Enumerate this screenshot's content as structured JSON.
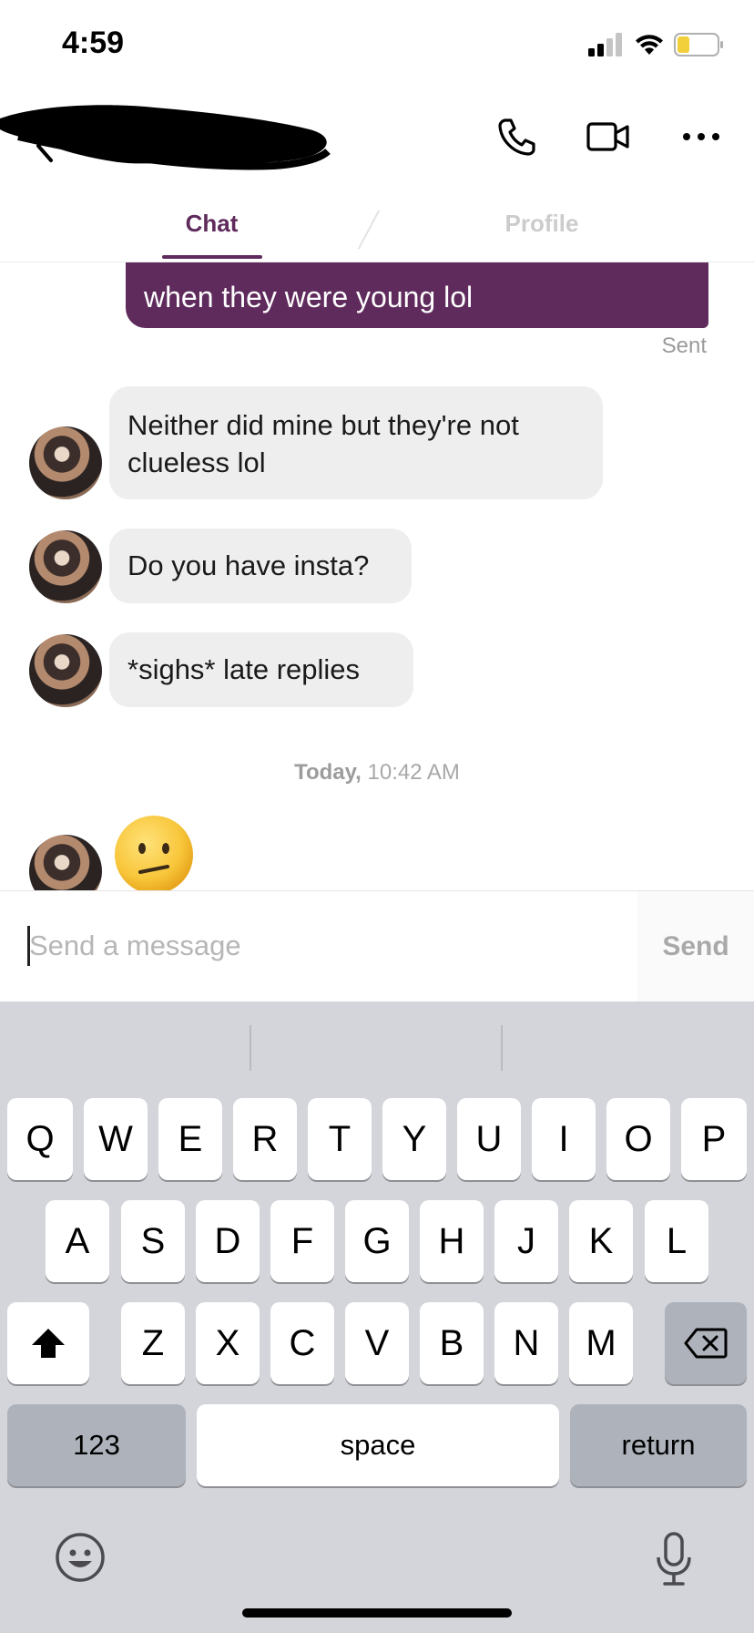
{
  "status_bar": {
    "time": "4:59"
  },
  "header": {
    "icons": {
      "back": "chevron-left-icon",
      "call": "phone-icon",
      "video": "video-camera-icon",
      "more": "ellipsis-icon"
    },
    "tabs": [
      {
        "label": "Chat",
        "active": true
      },
      {
        "label": "Profile",
        "active": false
      }
    ]
  },
  "chat": {
    "outgoing": {
      "text": "when they were young lol",
      "status": "Sent"
    },
    "incoming": [
      {
        "line1": "Neither did mine but they're not",
        "line2": "clueless lol"
      },
      {
        "text": "Do you have insta?"
      },
      {
        "text": "*sighs* late replies"
      }
    ],
    "timestamp": {
      "day": "Today,",
      "time": "10:42 AM"
    },
    "last_emoji": "confused-face-emoji"
  },
  "composer": {
    "placeholder": "Send a message",
    "value": "",
    "send_label": "Send"
  },
  "keyboard": {
    "row1": [
      "Q",
      "W",
      "E",
      "R",
      "T",
      "Y",
      "U",
      "I",
      "O",
      "P"
    ],
    "row2": [
      "A",
      "S",
      "D",
      "F",
      "G",
      "H",
      "J",
      "K",
      "L"
    ],
    "row3": [
      "Z",
      "X",
      "C",
      "V",
      "B",
      "N",
      "M"
    ],
    "numbers_label": "123",
    "space_label": "space",
    "return_label": "return"
  },
  "colors": {
    "brand": "#5f2b5c",
    "bubble_in": "#eeeeee",
    "keyboard_bg": "#d3d5db"
  }
}
